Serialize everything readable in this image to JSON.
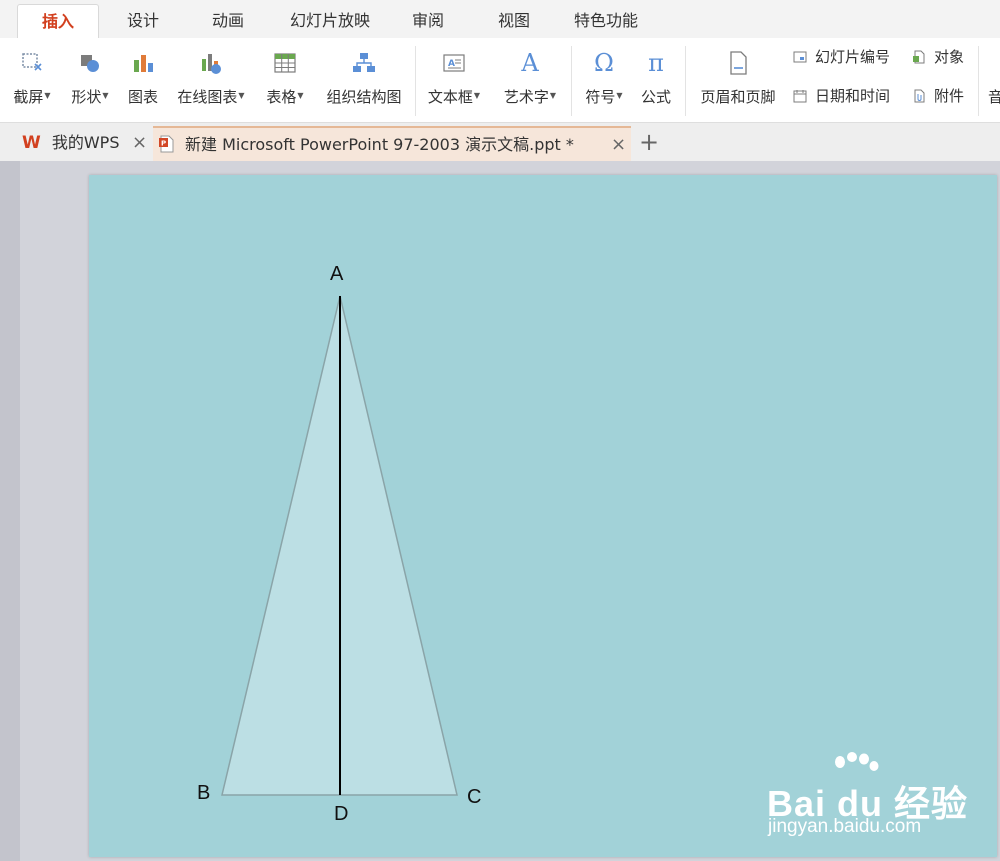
{
  "ribbon_tabs": {
    "insert": "插入",
    "design": "设计",
    "animation": "动画",
    "slideshow": "幻灯片放映",
    "review": "审阅",
    "view": "视图",
    "features": "特色功能"
  },
  "ribbon": {
    "screenshot": "截屏",
    "shapes": "形状",
    "chart": "图表",
    "online_chart": "在线图表",
    "table": "表格",
    "org_chart": "组织结构图",
    "textbox": "文本框",
    "wordart": "艺术字",
    "symbol": "符号",
    "equation": "公式",
    "header_footer": "页眉和页脚",
    "slide_number": "幻灯片编号",
    "object": "对象",
    "date_time": "日期和时间",
    "attachment": "附件",
    "cut_off": "音",
    "symbol_glyph": "Ω",
    "equation_glyph": "π",
    "wordart_glyph": "A"
  },
  "doc_tabs": {
    "home_tab": "我的WPS",
    "document_tab": "新建 Microsoft PowerPoint 97-2003 演示文稿.ppt *",
    "new_tab": "+",
    "close": "×"
  },
  "slide": {
    "vertex_a": "A",
    "vertex_b": "B",
    "vertex_c": "C",
    "point_d": "D"
  },
  "watermark": {
    "main": "Bai du 经验",
    "sub": "jingyan.baidu.com"
  },
  "colors": {
    "accent": "#d2401f",
    "slide_bg": "#a2d2d8",
    "triangle_fill": "#bcdfe4",
    "triangle_stroke": "#8aa4a8",
    "icon_blue": "#5b8fd6",
    "icon_green": "#6aa84f"
  }
}
